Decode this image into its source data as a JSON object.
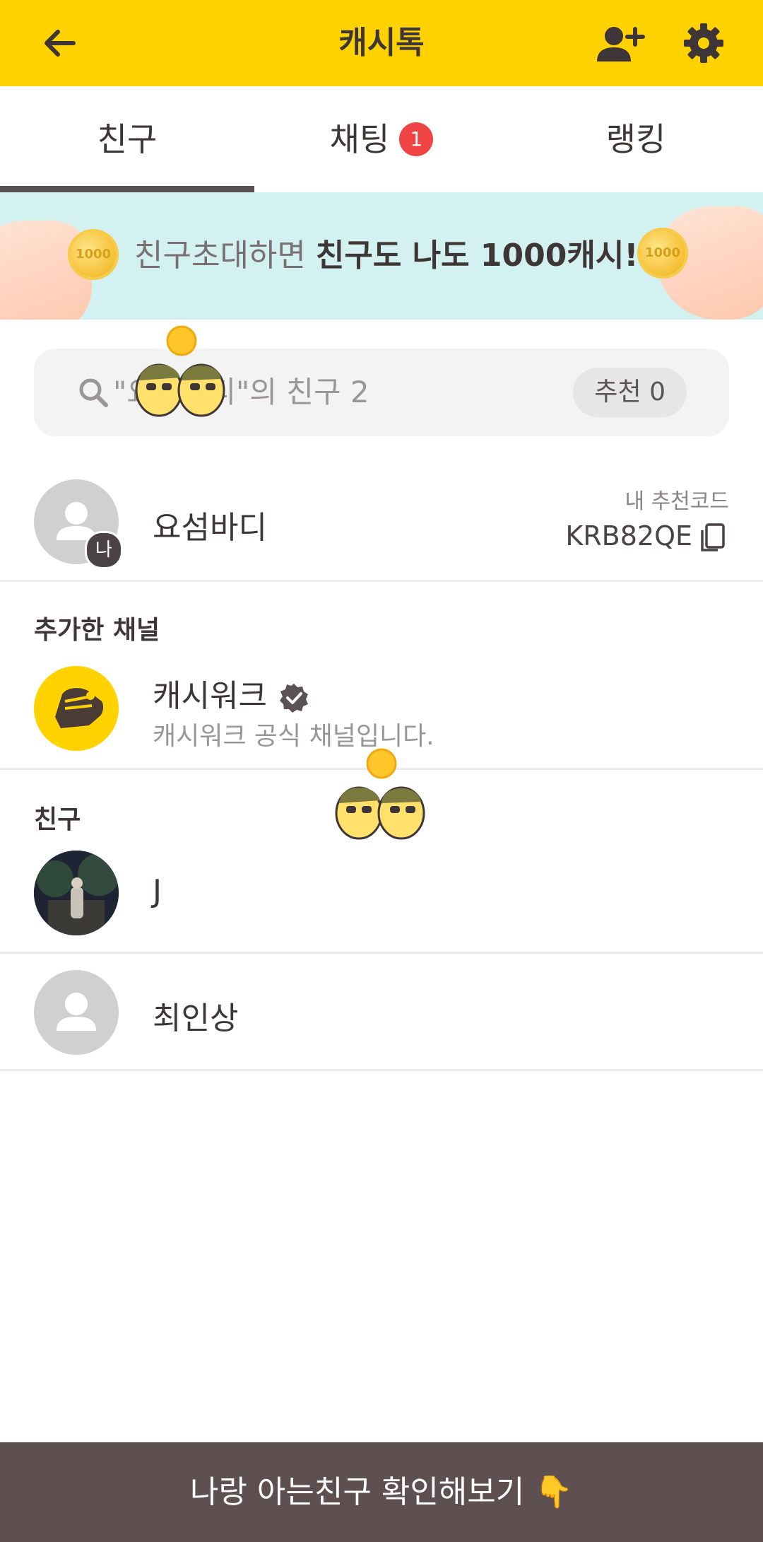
{
  "header": {
    "title": "캐시톡",
    "back_icon": "arrow-left-icon",
    "add_friend_icon": "person-add-icon",
    "settings_icon": "gear-icon",
    "color": "#ffd200"
  },
  "tabs": [
    {
      "label": "친구",
      "active": true
    },
    {
      "label": "채팅",
      "badge": "1"
    },
    {
      "label": "랭킹"
    }
  ],
  "banner": {
    "text_normal": "친구초대하면 ",
    "text_bold": "친구도 나도 1000캐시!",
    "coin_label": "1000"
  },
  "search": {
    "text": "\"요섬바디\"의 친구 2",
    "recommend_chip": "추천 0"
  },
  "me": {
    "name": "요섬바디",
    "badge": "나",
    "code_label": "내 추천코드",
    "code": "KRB82QE"
  },
  "channels": {
    "section_label": "추가한 채널",
    "items": [
      {
        "name": "캐시워크",
        "description": "캐시워크 공식 채널입니다."
      }
    ]
  },
  "friends": {
    "section_label": "친구",
    "items": [
      {
        "name": "J"
      },
      {
        "name": "최인상"
      }
    ]
  },
  "bottom_bar": {
    "text": "나랑 아는친구 확인해보기 👇"
  }
}
